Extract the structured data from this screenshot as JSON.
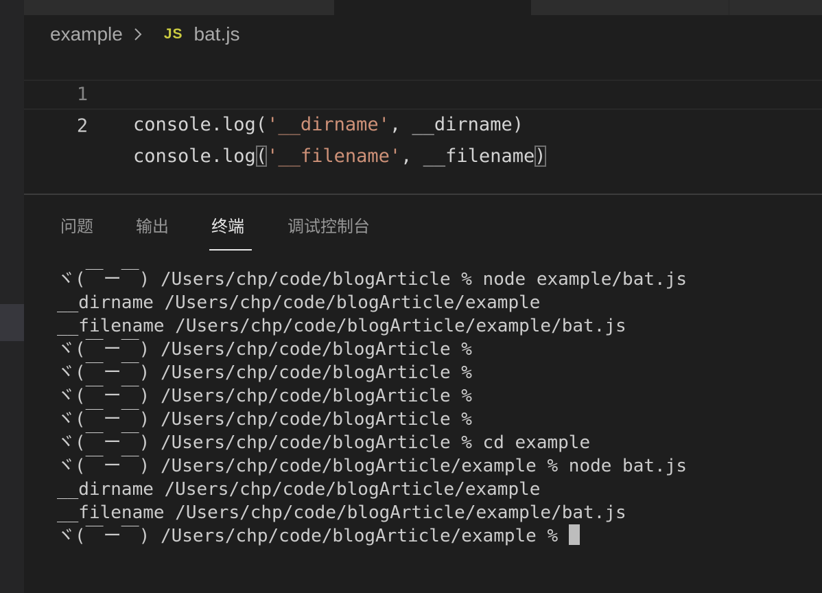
{
  "breadcrumb": {
    "folder": "example",
    "file_icon": "JS",
    "file": "bat.js"
  },
  "editor": {
    "lines": [
      {
        "number": "1",
        "parts": [
          "console.log(",
          "'__dirname'",
          ", __dirname)"
        ]
      },
      {
        "number": "2",
        "parts": [
          "console.log",
          "(",
          "'__filename'",
          ", __filename",
          ")"
        ]
      }
    ]
  },
  "panel": {
    "tabs": [
      "问题",
      "输出",
      "终端",
      "调试控制台"
    ],
    "active_tab": "终端"
  },
  "terminal": {
    "lines": [
      "ヾ(￣ー￣) /Users/chp/code/blogArticle % node example/bat.js",
      "__dirname /Users/chp/code/blogArticle/example",
      "__filename /Users/chp/code/blogArticle/example/bat.js",
      "ヾ(￣ー￣) /Users/chp/code/blogArticle %",
      "ヾ(￣ー￣) /Users/chp/code/blogArticle %",
      "ヾ(￣ー￣) /Users/chp/code/blogArticle %",
      "ヾ(￣ー￣) /Users/chp/code/blogArticle %",
      "ヾ(￣ー￣) /Users/chp/code/blogArticle % cd example",
      "ヾ(￣ー￣) /Users/chp/code/blogArticle/example % node bat.js",
      "__dirname /Users/chp/code/blogArticle/example",
      "__filename /Users/chp/code/blogArticle/example/bat.js",
      "ヾ(￣ー￣) /Users/chp/code/blogArticle/example % "
    ]
  },
  "colors": {
    "background": "#1e1e1e",
    "string": "#ce9178",
    "js_icon": "#cbcb41",
    "text": "#d4d4d4"
  }
}
